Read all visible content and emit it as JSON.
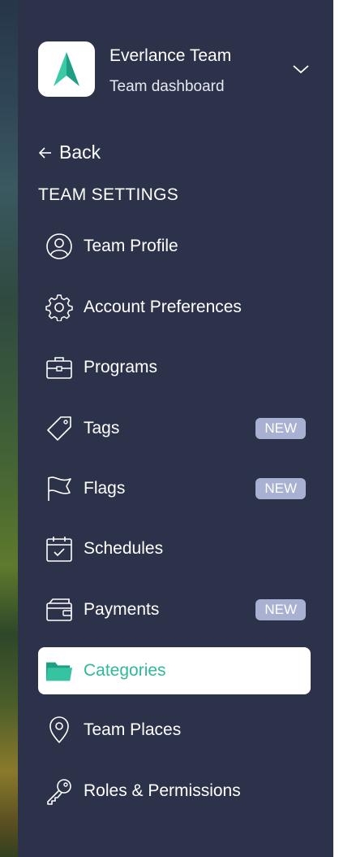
{
  "team": {
    "name": "Everlance Team",
    "subtitle": "Team dashboard"
  },
  "back_label": "Back",
  "section_title": "TEAM SETTINGS",
  "colors": {
    "sidebar_bg": "#2d324b",
    "accent": "#2fb99a",
    "badge_bg": "#a9b1d3"
  },
  "nav": [
    {
      "label": "Team Profile",
      "icon": "user-circle-icon",
      "badge": ""
    },
    {
      "label": "Account Preferences",
      "icon": "gear-icon",
      "badge": ""
    },
    {
      "label": "Programs",
      "icon": "briefcase-icon",
      "badge": ""
    },
    {
      "label": "Tags",
      "icon": "tag-icon",
      "badge": "NEW"
    },
    {
      "label": "Flags",
      "icon": "flag-icon",
      "badge": "NEW"
    },
    {
      "label": "Schedules",
      "icon": "calendar-check-icon",
      "badge": ""
    },
    {
      "label": "Payments",
      "icon": "wallet-icon",
      "badge": "NEW"
    },
    {
      "label": "Categories",
      "icon": "folder-icon",
      "badge": "",
      "active": true
    },
    {
      "label": "Team Places",
      "icon": "map-pin-icon",
      "badge": ""
    },
    {
      "label": "Roles & Permissions",
      "icon": "key-icon",
      "badge": ""
    }
  ]
}
